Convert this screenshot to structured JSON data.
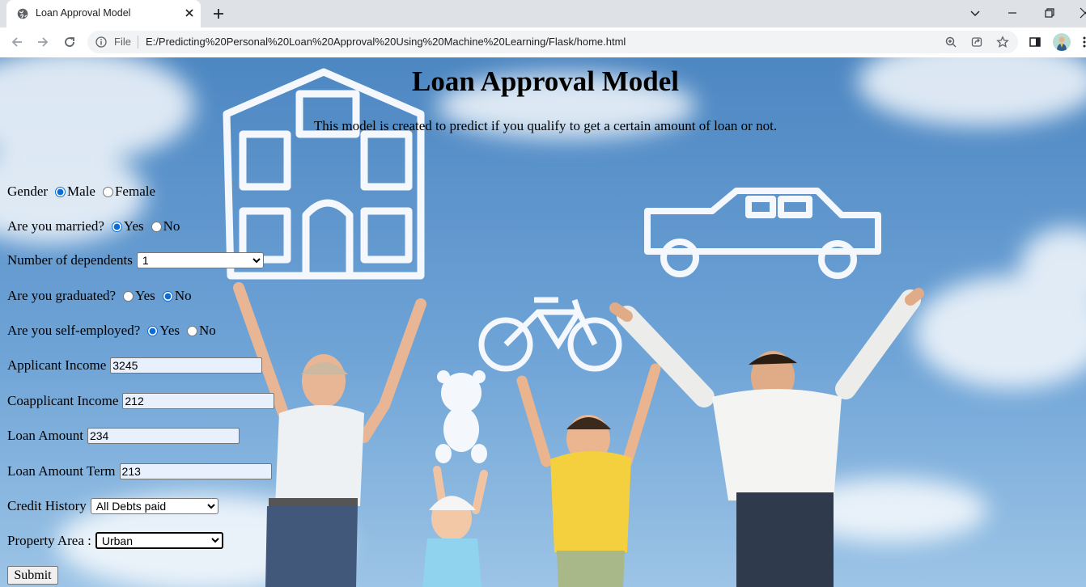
{
  "browser": {
    "tab_title": "Loan Approval Model",
    "file_label": "File",
    "url": "E:/Predicting%20Personal%20Loan%20Approval%20Using%20Machine%20Learning/Flask/home.html"
  },
  "page": {
    "title": "Loan Approval Model",
    "subtitle": "This model is created to predict if you qualify to get a certain amount of loan or not."
  },
  "form": {
    "gender": {
      "label": "Gender",
      "options": [
        "Male",
        "Female"
      ],
      "selected": "Male"
    },
    "married": {
      "label": "Are you married?",
      "options": [
        "Yes",
        "No"
      ],
      "selected": "Yes"
    },
    "dependents": {
      "label": "Number of dependents",
      "value": "1"
    },
    "graduated": {
      "label": "Are you graduated?",
      "options": [
        "Yes",
        "No"
      ],
      "selected": "No"
    },
    "self_employed": {
      "label": "Are you self-employed?",
      "options": [
        "Yes",
        "No"
      ],
      "selected": "Yes"
    },
    "applicant_income": {
      "label": "Applicant Income",
      "value": "3245"
    },
    "coapplicant_income": {
      "label": "Coapplicant Income",
      "value": "212"
    },
    "loan_amount": {
      "label": "Loan Amount",
      "value": "234"
    },
    "loan_amount_term": {
      "label": "Loan Amount Term",
      "value": "213"
    },
    "credit_history": {
      "label": "Credit History",
      "value": "All Debts paid"
    },
    "property_area": {
      "label": "Property Area :",
      "value": "Urban"
    },
    "submit_label": "Submit"
  },
  "colors": {
    "sky": "#5a94cf",
    "accent_radio": "#0a6cd8",
    "autofill_bg": "#e8f0fe"
  }
}
